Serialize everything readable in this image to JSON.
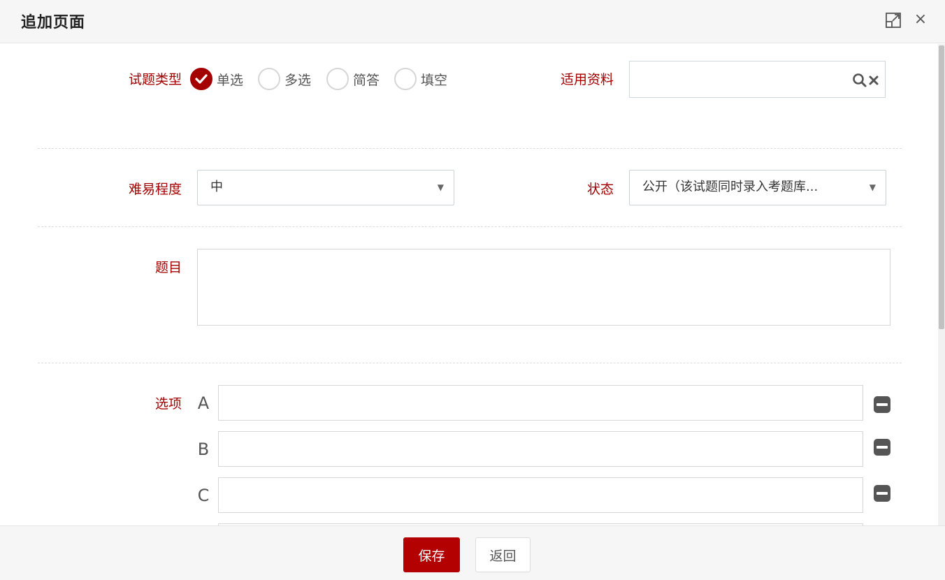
{
  "dialog": {
    "title": "追加页面",
    "maximize_icon": "maximize-icon",
    "close_icon": "close-icon",
    "close_glyph": "×"
  },
  "form": {
    "question_type": {
      "label": "试题类型",
      "options": [
        {
          "label": "单选",
          "checked": true
        },
        {
          "label": "多选",
          "checked": false
        },
        {
          "label": "简答",
          "checked": false
        },
        {
          "label": "填空",
          "checked": false
        }
      ]
    },
    "material": {
      "label": "适用资料",
      "value": "",
      "search_icon": "search-icon",
      "clear_icon": "clear-icon"
    },
    "difficulty": {
      "label": "难易程度",
      "value": "中"
    },
    "status": {
      "label": "状态",
      "value": "公开（该试题同时录入考题库..."
    },
    "question": {
      "label": "题目",
      "value": ""
    },
    "options": {
      "label": "选项",
      "items": [
        {
          "letter": "A",
          "value": ""
        },
        {
          "letter": "B",
          "value": ""
        },
        {
          "letter": "C",
          "value": ""
        }
      ],
      "remove_icon": "minus-square-icon"
    }
  },
  "footer": {
    "save_label": "保存",
    "back_label": "返回"
  },
  "colors": {
    "accent": "#a40000",
    "save_button": "#b30000",
    "header_bg": "#f6f6f6"
  }
}
